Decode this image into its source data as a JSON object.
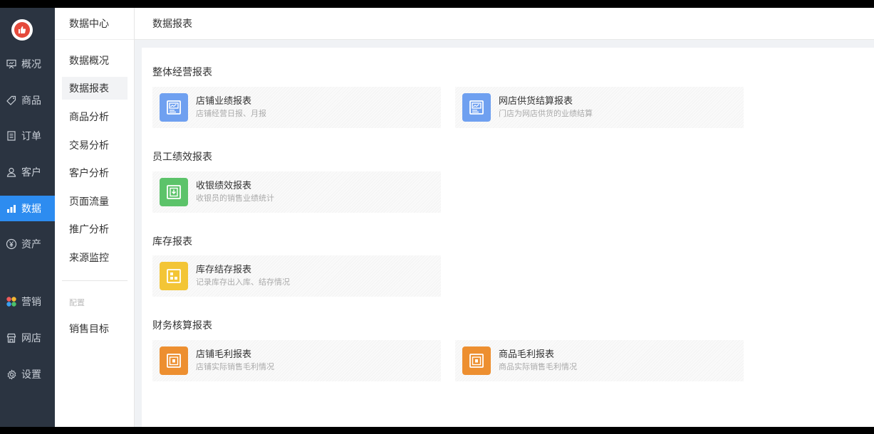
{
  "nav": {
    "items": [
      {
        "label": "概况",
        "icon": "overview-icon"
      },
      {
        "label": "商品",
        "icon": "tag-icon"
      },
      {
        "label": "订单",
        "icon": "order-icon"
      },
      {
        "label": "客户",
        "icon": "user-icon"
      },
      {
        "label": "数据",
        "icon": "bar-chart-icon",
        "active": true
      },
      {
        "label": "资产",
        "icon": "yuan-icon"
      },
      {
        "label": "营销",
        "icon": "apps-icon"
      },
      {
        "label": "网店",
        "icon": "store-icon"
      },
      {
        "label": "设置",
        "icon": "gear-icon"
      }
    ],
    "active_color": "#2d8cf0"
  },
  "submenu": {
    "title": "数据中心",
    "items": [
      "数据概况",
      "数据报表",
      "商品分析",
      "交易分析",
      "客户分析",
      "页面流量",
      "推广分析",
      "来源监控"
    ],
    "active_index": 1,
    "group_label": "配置",
    "group_items": [
      "销售目标"
    ]
  },
  "header": {
    "title": "数据报表"
  },
  "sections": [
    {
      "title": "整体经营报表",
      "cards": [
        {
          "title": "店铺业绩报表",
          "desc": "店铺经营日报、月报",
          "color": "#6fa0f0",
          "icon": "report-chart-icon"
        },
        {
          "title": "网店供货结算报表",
          "desc": "门店为网店供货的业绩结算",
          "color": "#6fa0f0",
          "icon": "report-chart-icon"
        }
      ]
    },
    {
      "title": "员工绩效报表",
      "cards": [
        {
          "title": "收银绩效报表",
          "desc": "收银员的销售业绩统计",
          "color": "#5cc36a",
          "icon": "download-icon"
        }
      ]
    },
    {
      "title": "库存报表",
      "cards": [
        {
          "title": "库存结存报表",
          "desc": "记录库存出入库、结存情况",
          "color": "#f3c536",
          "icon": "inventory-icon"
        }
      ]
    },
    {
      "title": "财务核算报表",
      "cards": [
        {
          "title": "店铺毛利报表",
          "desc": "店铺实际销售毛利情况",
          "color": "#ed8f30",
          "icon": "finance-icon"
        },
        {
          "title": "商品毛利报表",
          "desc": "商品实际销售毛利情况",
          "color": "#ed8f30",
          "icon": "finance-icon"
        }
      ]
    }
  ]
}
